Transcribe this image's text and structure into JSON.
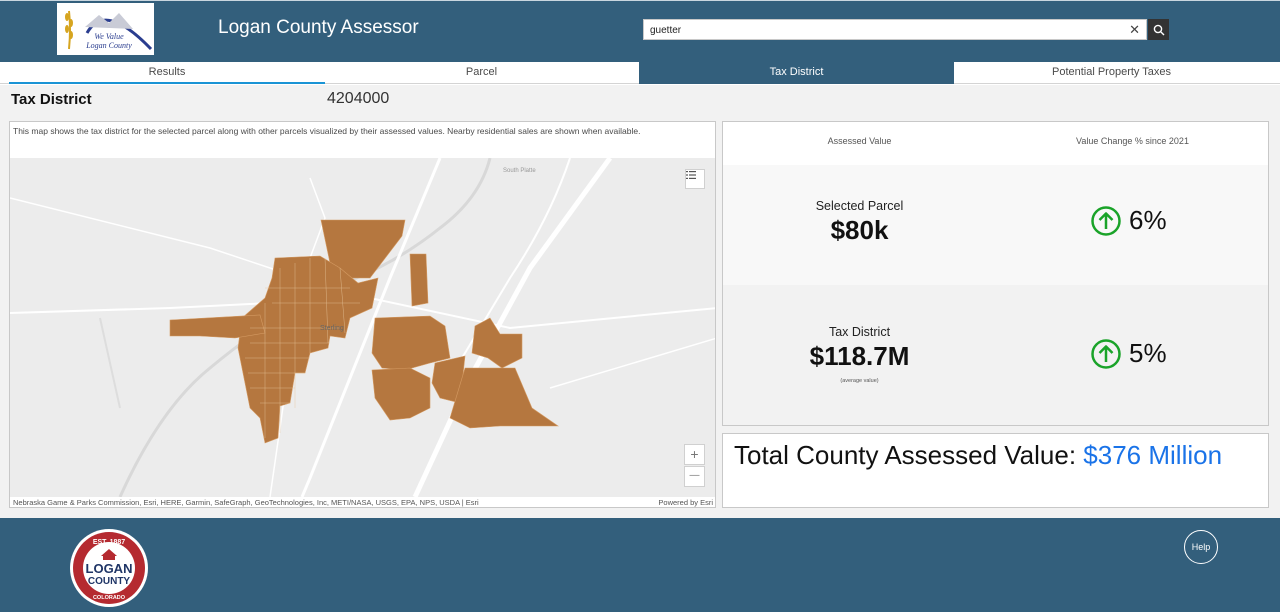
{
  "header": {
    "logo_text_line1": "We Value",
    "logo_text_line2": "Logan County",
    "title": "Logan County Assessor",
    "search_value": "guetter",
    "clear_icon": "close-icon",
    "search_icon": "search-icon"
  },
  "tabs": [
    {
      "label": "Results"
    },
    {
      "label": "Parcel"
    },
    {
      "label": "Tax District"
    },
    {
      "label": "Potential Property Taxes"
    }
  ],
  "subheader": {
    "title": "Tax District",
    "id": "4204000"
  },
  "map": {
    "description": "This map shows the tax district for the selected parcel along with other parcels visualized by their assessed values. Nearby residential sales are shown when available.",
    "town_label": "Sterling",
    "river_label": "South Platte",
    "attribution": "Nebraska Game & Parks Commission, Esri, HERE, Garmin, SafeGraph, GeoTechnologies, Inc, METI/NASA, USGS, EPA, NPS, USDA | Esri",
    "powered_by": "Powered by Esri",
    "zoom_in": "+",
    "zoom_out": "—",
    "district_color": "#b5773f"
  },
  "stats": {
    "col1_header": "Assessed Value",
    "col2_header": "Value Change % since 2021",
    "selected_label": "Selected Parcel",
    "selected_value": "$80k",
    "selected_change": "6%",
    "district_label": "Tax District",
    "district_value": "$118.7M",
    "district_note": "(average value)",
    "district_change": "5%",
    "arrow_color": "#1aa329"
  },
  "total": {
    "label": "Total County Assessed Value:",
    "value": "$376 Million"
  },
  "footer": {
    "seal_est": "EST. 1887",
    "seal_name1": "LOGAN",
    "seal_name2": "COUNTY",
    "seal_state": "COLORADO",
    "help_label": "Help"
  }
}
